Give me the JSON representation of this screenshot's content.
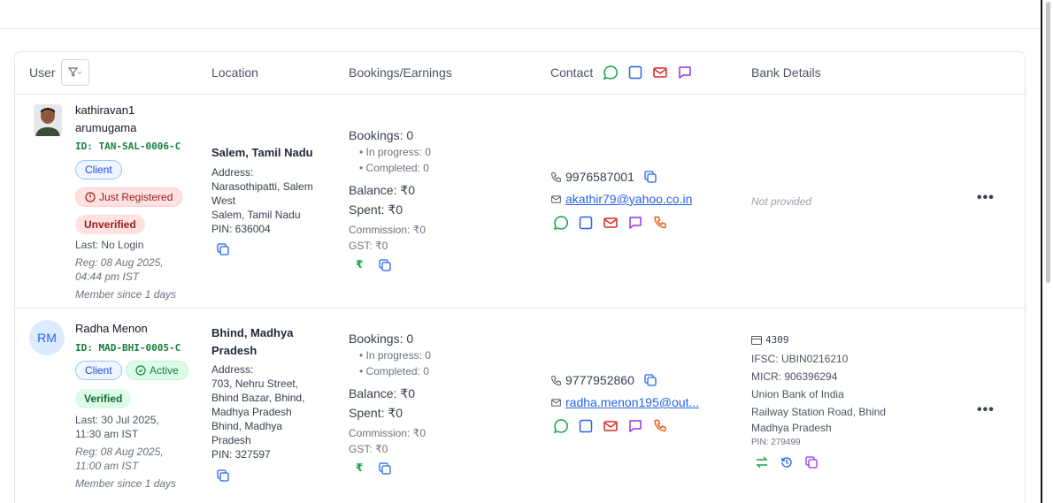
{
  "header": {
    "user": "User",
    "location": "Location",
    "bookings": "Bookings/Earnings",
    "contact": "Contact",
    "bank": "Bank Details"
  },
  "rows": [
    {
      "name_first": "kathiravan1",
      "name_last": "arumugama",
      "id": "ID: TAN-SAL-0006-C",
      "role": "Client",
      "status": "Just Registered",
      "verification": "Unverified",
      "last_login": "Last: No Login",
      "reg": "Reg: 08 Aug 2025, 04:44 pm IST",
      "member": "Member since 1 days",
      "city": "Salem, Tamil Nadu",
      "address_label": "Address:",
      "address": "Narasothipatti, Salem West",
      "address_city": "Salem, Tamil Nadu",
      "pin": "PIN: 636004",
      "bookings": "Bookings: 0",
      "in_progress": "• In progress: 0",
      "completed": "• Completed: 0",
      "balance": "Balance: ₹0",
      "spent": "Spent: ₹0",
      "commission": "Commission: ₹0",
      "gst": "GST: ₹0",
      "phone": "9976587001",
      "email": "akathir79@yahoo.co.in",
      "bank_status": "Not provided"
    },
    {
      "avatar_initials": "RM",
      "name": "Radha Menon",
      "id": "ID: MAD-BHI-0005-C",
      "role": "Client",
      "status": "Active",
      "verification": "Verified",
      "last_login": "Last: 30 Jul 2025, 11:30 am IST",
      "reg": "Reg: 08 Aug 2025, 11:00 am IST",
      "member": "Member since 1 days",
      "city": "Bhind, Madhya Pradesh",
      "address_label": "Address:",
      "address": "703, Nehru Street, Bhind Bazar, Bhind, Madhya Pradesh",
      "address_city": "Bhind, Madhya Pradesh",
      "pin": "PIN: 327597",
      "bookings": "Bookings: 0",
      "in_progress": "• In progress: 0",
      "completed": "• Completed: 0",
      "balance": "Balance: ₹0",
      "spent": "Spent: ₹0",
      "commission": "Commission: ₹0",
      "gst": "GST: ₹0",
      "phone": "9777952860",
      "email": "radha.menon195@out...",
      "bank_acc": "4309",
      "ifsc": "IFSC: UBIN0216210",
      "micr": "MICR: 906396294",
      "bank_name": "Union Bank of India",
      "branch": "Railway Station Road, Bhind",
      "state": "Madhya Pradesh",
      "bank_pin": "PIN: 279499"
    }
  ],
  "colors": {
    "whatsapp": "#16a34a",
    "square": "#2563eb",
    "mail": "#dc2626",
    "chat": "#9333ea",
    "call": "#ea580c",
    "copy": "#2563eb"
  }
}
